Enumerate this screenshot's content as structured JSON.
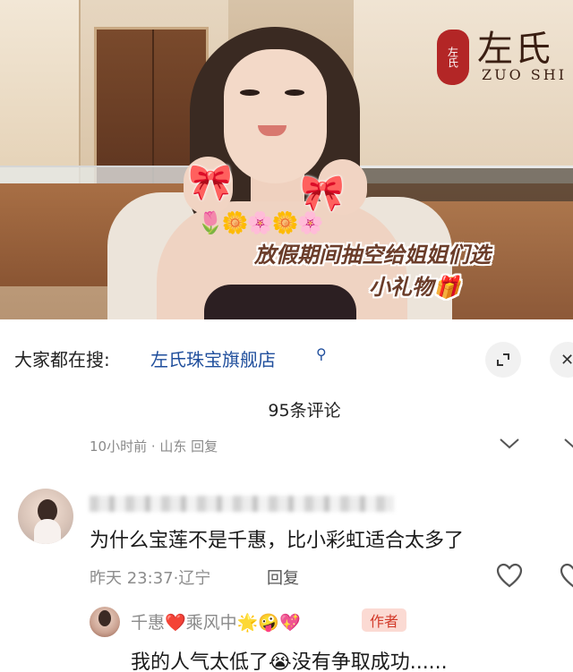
{
  "video": {
    "brand_seal": "左氏",
    "brand_cn": "左氏",
    "brand_en": "ZUO SHI",
    "bow_sticker": "🎀",
    "flowers_sticker": "🌷🌼🌸🌼🌸",
    "caption_line1": "放假期间抽空给姐姐们选",
    "caption_line2": "小礼物🎁"
  },
  "search": {
    "prefix": "大家都在搜:",
    "query": "左氏珠宝旗舰店",
    "search_glyph": "⚲",
    "expand_glyph": "⌟",
    "close_glyph": "✕"
  },
  "comments": {
    "count_label": "95条评论",
    "faded_row": "10小时前 · 山东   回复"
  },
  "comment": {
    "text": "为什么宝莲不是千惠，比小彩虹适合太多了",
    "time_location": "昨天 23:37·辽宁",
    "reply_label": "回复"
  },
  "reply": {
    "name": "千惠❤️乘风中🌟🤪💖",
    "author_badge": "作者",
    "text": "我的人气太低了😭没有争取成功......"
  },
  "colors": {
    "link_blue": "#1f4e9c",
    "badge_bg": "#fbdad3",
    "badge_text": "#d23a2a",
    "caption_brown": "#6b3d2a"
  }
}
